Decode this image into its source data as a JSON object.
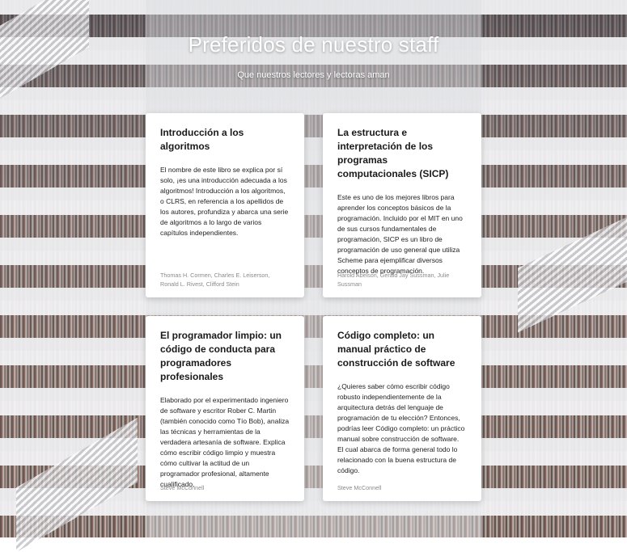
{
  "header": {
    "title": "Preferidos de nuestro staff",
    "subtitle": "Que nuestros lectores y lectoras aman"
  },
  "books": [
    {
      "title": "Introducción a los algoritmos",
      "description": "El nombre de este libro se explica por sí solo, ¡es una introducción adecuada a los algoritmos! Introducción a los algoritmos, o CLRS, en referencia a los apellidos de los autores, profundiza y abarca una serie de algoritmos a lo largo de varios capítulos independientes.",
      "authors": "Thomas H. Cormen, Charles E. Leiserson, Ronald L. Rivest, Clifford Stein"
    },
    {
      "title": "La estructura e interpretación de los programas computacionales (SICP)",
      "description": "Este es uno de los mejores libros para aprender los conceptos básicos de la programación. Incluido por el MIT en uno de sus cursos fundamentales de programación, SICP es un libro de programación de uso general que utiliza Scheme para ejemplificar diversos conceptos de programación.",
      "authors": "Harold Abelson, Gerald Jay Sussman, Julie Sussman"
    },
    {
      "title": "El programador limpio: un código de conducta para programadores profesionales",
      "description": "Elaborado por el experimentado ingeniero de software y escritor Rober C. Martin (también conocido como Tío Bob), analiza las técnicas y herramientas de la verdadera artesanía de software. Explica cómo escribir código limpio y muestra cómo cultivar la actitud de un programador profesional, altamente cualificado.",
      "authors": "Steve McConnell"
    },
    {
      "title": "Código completo: un manual práctico de construcción de software",
      "description": "¿Quieres saber cómo escribir código robusto independientemente de la arquitectura detrás del lenguaje de programación de tu elección? Entonces, podrías leer Código completo: un práctico manual sobre construcción de software. El cual abarca de forma general todo lo relacionado con la buena estructura de código.",
      "authors": "Steve McConnell"
    }
  ]
}
